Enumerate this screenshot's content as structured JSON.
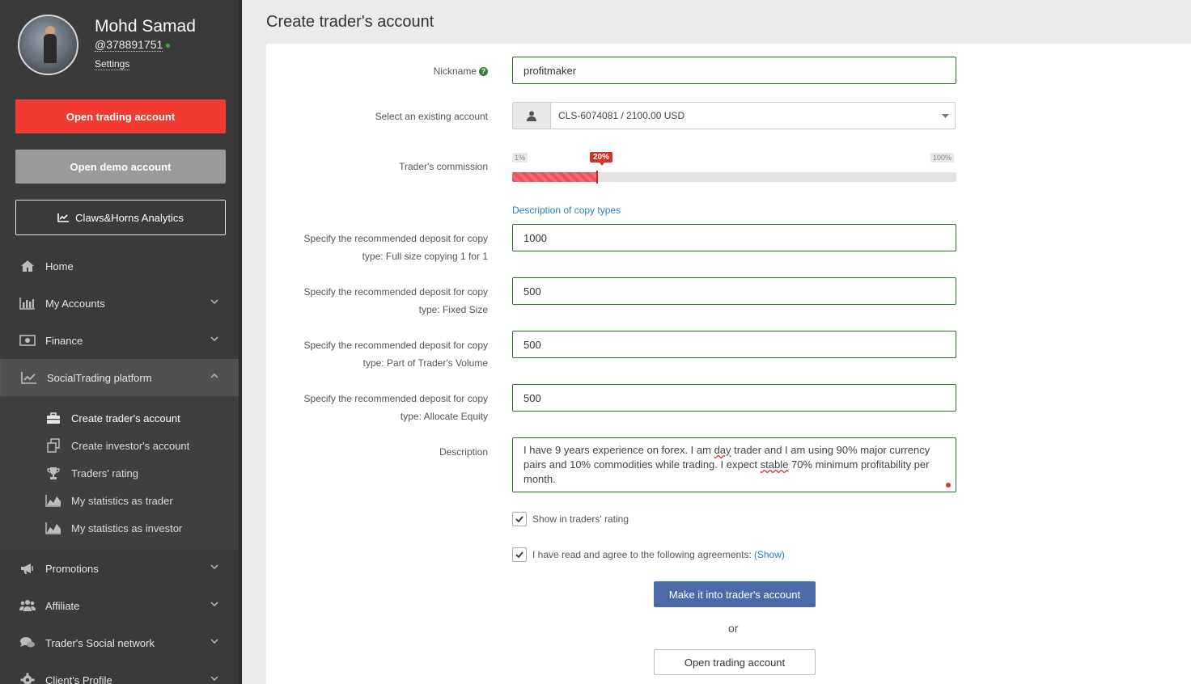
{
  "user": {
    "name": "Mohd Samad",
    "id": "@378891751",
    "settings_label": "Settings",
    "online": true
  },
  "sidebar": {
    "buttons": {
      "open_trading": "Open trading account",
      "open_demo": "Open demo account",
      "analytics": "Claws&Horns Analytics"
    },
    "nav": [
      {
        "label": "Home",
        "icon": "home-icon"
      },
      {
        "label": "My Accounts",
        "icon": "bar-chart-icon"
      },
      {
        "label": "Finance",
        "icon": "money-icon"
      },
      {
        "label": "SocialTrading platform",
        "icon": "line-chart-icon"
      },
      {
        "label": "Promotions",
        "icon": "megaphone-icon"
      },
      {
        "label": "Affiliate",
        "icon": "users-icon"
      },
      {
        "label": "Trader's Social network",
        "icon": "chat-icon"
      },
      {
        "label": "Client's Profile",
        "icon": "gear-icon"
      }
    ],
    "submenu": [
      {
        "label": "Create trader's account",
        "icon": "briefcase-icon"
      },
      {
        "label": "Create investor's account",
        "icon": "copy-icon"
      },
      {
        "label": "Traders' rating",
        "icon": "trophy-icon"
      },
      {
        "label": "My statistics as trader",
        "icon": "area-chart-icon"
      },
      {
        "label": "My statistics as investor",
        "icon": "area-chart-icon"
      }
    ]
  },
  "page": {
    "title": "Create trader's account"
  },
  "form": {
    "nickname_label": "Nickname",
    "nickname_value": "profitmaker",
    "account_label": "Select an existing account",
    "account_value": "CLS-6074081 / 2100.00 USD",
    "commission_label": "Trader's commission",
    "commission_min": "1%",
    "commission_max": "100%",
    "commission_current": "20%",
    "commission_value_percent": 20,
    "copy_types_link": "Description of copy types",
    "deposits": [
      {
        "label": "Specify the recommended deposit for copy type: Full size copying 1 for 1",
        "value": "1000"
      },
      {
        "label": "Specify the recommended deposit for copy type: Fixed Size",
        "value": "500"
      },
      {
        "label": "Specify the recommended deposit for copy type: Part of Trader's Volume",
        "value": "500"
      },
      {
        "label": "Specify the recommended deposit for copy type: Allocate Equity",
        "value": "500"
      }
    ],
    "description_label": "Description",
    "description_parts": {
      "p1": "I have 9 years experience on forex. I am ",
      "w1": "day",
      "p2": " trader and I am using 90% major currency pairs and 10% commodities while trading. I expect ",
      "w2": "stable",
      "p3": " 70% minimum profitability per month."
    },
    "show_rating_label": "Show in traders' rating",
    "show_rating_checked": true,
    "agree_label": "I have read and agree to the following agreements:",
    "agree_link": "(Show)",
    "agree_checked": true,
    "submit_label": "Make it into trader's account",
    "or_label": "or",
    "open_trading_label": "Open trading account"
  },
  "colors": {
    "accent_red": "#f33a32",
    "primary_blue": "#4a6aa8",
    "link_blue": "#2d82b5",
    "input_border_green": "#2f6b2f"
  }
}
